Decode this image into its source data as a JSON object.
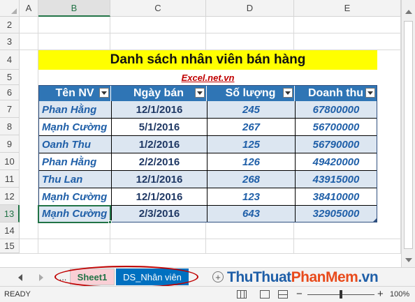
{
  "columns": [
    "A",
    "B",
    "C",
    "D",
    "E"
  ],
  "rows": [
    "2",
    "3",
    "4",
    "5",
    "6",
    "7",
    "8",
    "9",
    "10",
    "11",
    "12",
    "13",
    "14",
    "15"
  ],
  "title": "Danh sách nhân viên bán hàng",
  "watermark_url": "Excel.net.vn",
  "table": {
    "headers": [
      "Tên NV",
      "Ngày bán",
      "Số lượng",
      "Doanh thu"
    ],
    "rows": [
      [
        "Phan Hằng",
        "12/1/2016",
        "245",
        "67800000"
      ],
      [
        "Mạnh Cường",
        "5/1/2016",
        "267",
        "56700000"
      ],
      [
        "Oanh Thu",
        "1/2/2016",
        "125",
        "56790000"
      ],
      [
        "Phan Hằng",
        "2/2/2016",
        "126",
        "49420000"
      ],
      [
        "Thu Lan",
        "12/1/2016",
        "268",
        "43915000"
      ],
      [
        "Mạnh Cường",
        "12/1/2016",
        "123",
        "38410000"
      ],
      [
        "Mạnh Cường",
        "2/3/2016",
        "643",
        "32905000"
      ]
    ]
  },
  "sheet_tabs": {
    "ellipsis": "...",
    "sheet1": "Sheet1",
    "active": "DS_Nhân viên"
  },
  "status": {
    "mode": "READY",
    "zoom": "100%",
    "plus": "+",
    "minus": "−"
  },
  "brand": {
    "part1": "Thu",
    "part2": "Thuat",
    "part3": "PhanMem",
    "part4": ".vn"
  },
  "colors": {
    "header_blue": "#2f75b5",
    "title_yellow": "#ffff00",
    "band_blue": "#dce6f1",
    "excel_green": "#217346",
    "highlight_red": "#c00000"
  }
}
